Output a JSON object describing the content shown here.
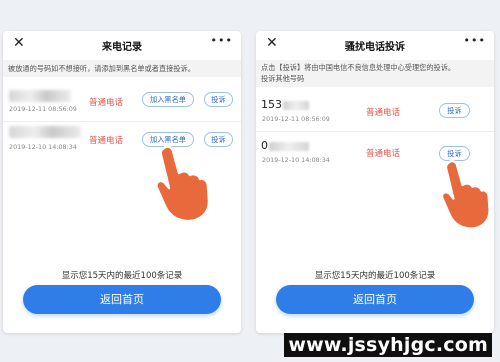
{
  "left": {
    "title": "来电记录",
    "close_icon": "✕",
    "more_icon": "•••",
    "notice": "被放通的号码如不想接听，请添加到黑名单或者直接投诉。",
    "records": [
      {
        "time": "2019-12-11 08:56:09",
        "type": "普通电话",
        "add_label": "加入黑名单",
        "report_label": "投诉"
      },
      {
        "time": "2019-12-10 14:08:34",
        "type": "普通电话",
        "add_label": "加入黑名单",
        "report_label": "投诉"
      }
    ],
    "footer_text": "显示您15天内的最近100条记录",
    "home_label": "返回首页"
  },
  "right": {
    "title": "骚扰电话投诉",
    "close_icon": "✕",
    "more_icon": "•••",
    "notice_line1": "点击【投诉】将由中国电信不良信息处理中心受理您的投诉。",
    "notice_line2": "投诉其他号码",
    "records": [
      {
        "number_prefix": "153",
        "time": "2019-12-11 08:56:09",
        "type": "普通电话",
        "report_label": "投诉"
      },
      {
        "number_prefix": "0",
        "time": "2019-12-10 14:08:34",
        "type": "普通电话",
        "report_label": "投诉"
      }
    ],
    "footer_text": "显示您15天内的最近100条记录",
    "home_label": "返回首页"
  },
  "watermark": "www.jssyhjgc.com",
  "colors": {
    "accent": "#2e7de8",
    "call_type": "#e4544a",
    "hand": "#e8693b"
  }
}
